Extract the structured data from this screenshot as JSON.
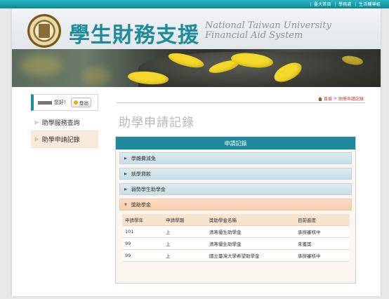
{
  "top_links": [
    "臺大首頁",
    "學務處",
    "生活輔導組"
  ],
  "site": {
    "title_zh": "學生財務支援",
    "title_en_line1": "National Taiwan University",
    "title_en_line2": "Financial Aid System"
  },
  "greeting": {
    "text": "您好！",
    "logout_label": "登出"
  },
  "sidebar": {
    "items": [
      {
        "label": "助學服務查詢"
      },
      {
        "label": "助學申請記錄"
      }
    ]
  },
  "breadcrumb": {
    "home": "首頁",
    "sep": ">",
    "current": "助學申請記錄"
  },
  "page_title": "助學申請記錄",
  "panel": {
    "heading": "申請記錄",
    "categories": [
      "學雜費減免",
      "就學貸款",
      "弱勢學生助學金",
      "獎助學金"
    ],
    "table": {
      "headers": [
        "申請學年",
        "申請學期",
        "獎助學金名稱",
        "目前進度"
      ],
      "rows": [
        [
          "101",
          "上",
          "清寒優生助學金",
          "承辦審核中"
        ],
        [
          "99",
          "上",
          "清寒優生助學金",
          "未獲獎"
        ],
        [
          "99",
          "上",
          "國立臺灣大學希望助學金",
          "承辦審核中"
        ]
      ]
    }
  }
}
